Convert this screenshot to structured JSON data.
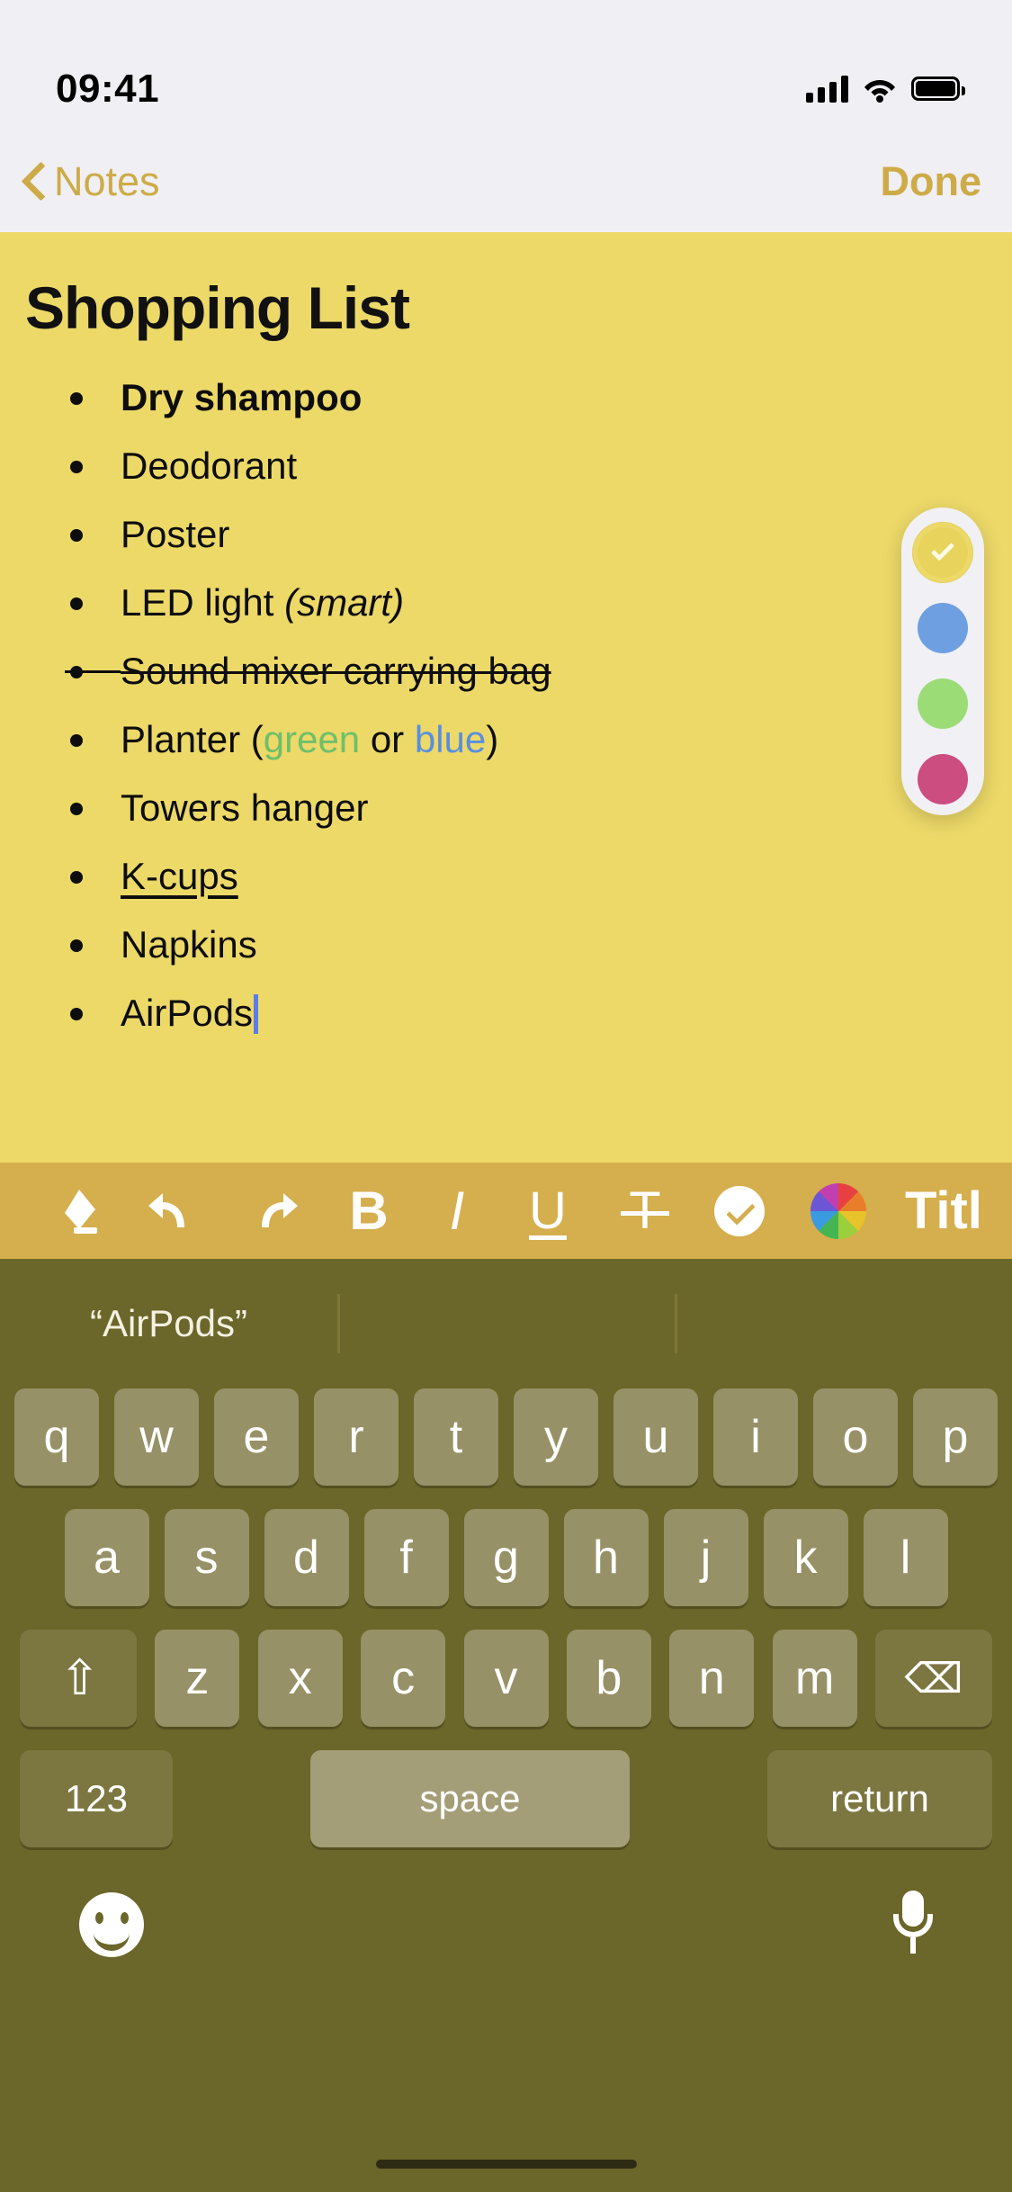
{
  "status_bar": {
    "time": "09:41",
    "signal_icon": "cellular-signal-icon",
    "wifi_icon": "wifi-icon",
    "battery_icon": "battery-icon"
  },
  "nav_bar": {
    "back_label": "Notes",
    "back_icon": "chevron-left-icon",
    "done_label": "Done"
  },
  "note": {
    "title": "Shopping List",
    "background_color": "#ecd968",
    "items": [
      {
        "text": "Dry shampoo",
        "style": "bold"
      },
      {
        "text": "Deodorant",
        "style": "plain"
      },
      {
        "text": "Poster",
        "style": "plain"
      },
      {
        "text": "LED light ",
        "suffix": "(smart)",
        "style": "italic-suffix"
      },
      {
        "text": "Sound mixer carrying bag",
        "style": "strikethrough"
      },
      {
        "text": "Planter (",
        "mid1": "green",
        "mid2": " or ",
        "mid3": "blue",
        "tail": ")",
        "style": "colored"
      },
      {
        "text": "Towers hanger",
        "style": "plain"
      },
      {
        "text": " K-cups",
        "style": "underline"
      },
      {
        "text": "Napkins",
        "style": "plain"
      },
      {
        "text": "AirPods",
        "style": "caret"
      }
    ],
    "colors": {
      "green_text": "#6fbf6a",
      "blue_text": "#5b8fdd",
      "caret": "#5b7de8"
    }
  },
  "color_picker": {
    "swatches": [
      {
        "name": "yellow",
        "color": "#e8d45c",
        "selected": true
      },
      {
        "name": "blue",
        "color": "#6e9fe0",
        "selected": false
      },
      {
        "name": "green",
        "color": "#9bdc77",
        "selected": false
      },
      {
        "name": "pink",
        "color": "#cc4d80",
        "selected": false
      }
    ],
    "check_icon": "checkmark-icon"
  },
  "format_toolbar": {
    "background_color": "#d5ae4d",
    "buttons": [
      {
        "name": "eraser-icon",
        "label": ""
      },
      {
        "name": "undo-icon",
        "label": "↶"
      },
      {
        "name": "redo-icon",
        "label": "↷"
      },
      {
        "name": "bold-icon",
        "label": "B"
      },
      {
        "name": "italic-icon",
        "label": "I"
      },
      {
        "name": "underline-icon",
        "label": "U"
      },
      {
        "name": "strikethrough-icon",
        "label": "T"
      },
      {
        "name": "checklist-icon",
        "label": ""
      },
      {
        "name": "color-wheel-icon",
        "label": ""
      },
      {
        "name": "title-style-button",
        "label": "Titl"
      }
    ]
  },
  "keyboard": {
    "background_color": "#6b6629",
    "suggestions": [
      "“AirPods”",
      "",
      ""
    ],
    "row1": [
      "q",
      "w",
      "e",
      "r",
      "t",
      "y",
      "u",
      "i",
      "o",
      "p"
    ],
    "row2": [
      "a",
      "s",
      "d",
      "f",
      "g",
      "h",
      "j",
      "k",
      "l"
    ],
    "row3": [
      "z",
      "x",
      "c",
      "v",
      "b",
      "n",
      "m"
    ],
    "shift_icon": "shift-icon",
    "delete_icon": "delete-icon",
    "numbers_key": "123",
    "space_key": "space",
    "return_key": "return",
    "emoji_icon": "emoji-icon",
    "dictation_icon": "microphone-icon"
  }
}
